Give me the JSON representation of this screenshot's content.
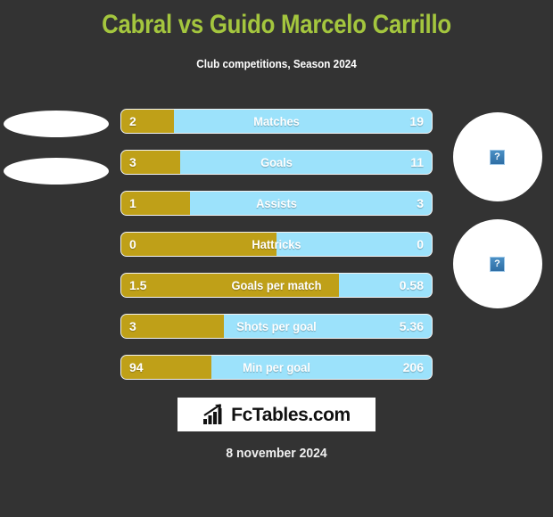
{
  "header": {
    "title": "Cabral vs Guido Marcelo Carrillo",
    "subtitle": "Club competitions, Season 2024",
    "title_color": "#a4c63e",
    "background_color": "#333333"
  },
  "players": {
    "home": {
      "image_placeholder": "broken-image",
      "shape": "ellipse"
    },
    "away": {
      "image_placeholder": "broken-image",
      "glyph": "?",
      "shape": "circle"
    }
  },
  "colors": {
    "home_bar": "#bfa018",
    "away_bar": "#9ce2fb",
    "bar_border": "#f2f2f2"
  },
  "chart_data": {
    "type": "bar",
    "title": "Cabral vs Guido Marcelo Carrillo",
    "subtitle": "Club competitions, Season 2024",
    "orientation": "horizontal-diverging",
    "categories": [
      "Matches",
      "Goals",
      "Assists",
      "Hattricks",
      "Goals per match",
      "Shots per goal",
      "Min per goal"
    ],
    "series": [
      {
        "name": "Cabral",
        "values": [
          "2",
          "3",
          "1",
          "0",
          "1.5",
          "3",
          "94"
        ]
      },
      {
        "name": "Guido Marcelo Carrillo",
        "values": [
          "19",
          "11",
          "3",
          "0",
          "0.58",
          "5.36",
          "206"
        ]
      }
    ],
    "home_fill_percent": [
      17,
      19,
      22,
      50,
      70,
      33,
      29
    ],
    "legend": "none",
    "grid": false
  },
  "stats": [
    {
      "label": "Matches",
      "home": "2",
      "away": "19",
      "fill": 17
    },
    {
      "label": "Goals",
      "home": "3",
      "away": "11",
      "fill": 19
    },
    {
      "label": "Assists",
      "home": "1",
      "away": "3",
      "fill": 22
    },
    {
      "label": "Hattricks",
      "home": "0",
      "away": "0",
      "fill": 50
    },
    {
      "label": "Goals per match",
      "home": "1.5",
      "away": "0.58",
      "fill": 70
    },
    {
      "label": "Shots per goal",
      "home": "3",
      "away": "5.36",
      "fill": 33
    },
    {
      "label": "Min per goal",
      "home": "94",
      "away": "206",
      "fill": 29
    }
  ],
  "logo": {
    "text": "FcTables.com",
    "icon": "bar-chart-icon"
  },
  "footer": {
    "date": "8 november 2024"
  }
}
